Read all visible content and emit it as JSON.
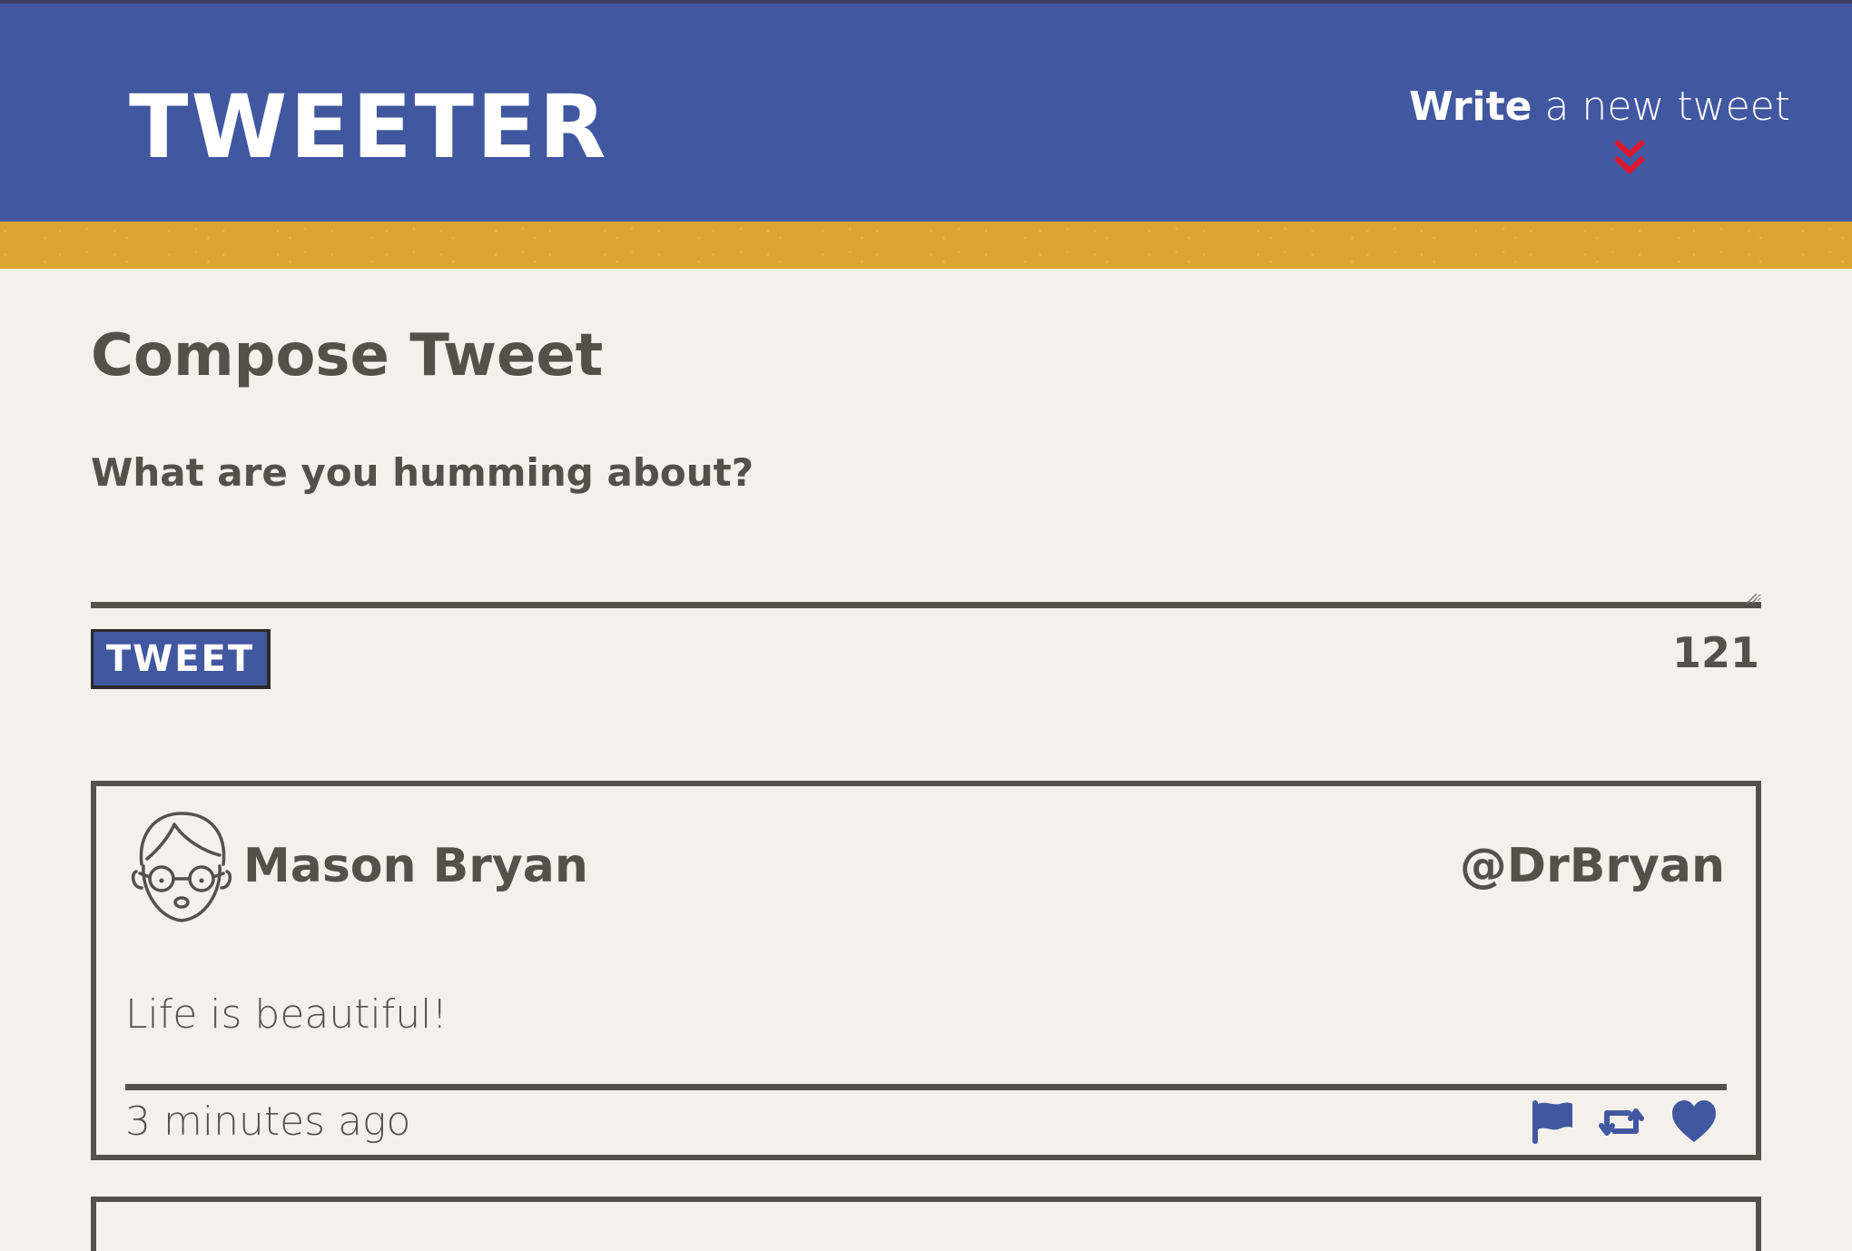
{
  "nav": {
    "brand": "TWEETER",
    "write_bold": "Write",
    "write_rest": " a new tweet",
    "chevron_icon": "double-chevron-down-icon",
    "colors": {
      "nav_bg": "#4158a0",
      "accent_stripe": "#dca532",
      "chevron": "#e0182e"
    }
  },
  "compose": {
    "title": "Compose Tweet",
    "prompt": "What are you humming about?",
    "input_value": "",
    "submit_label": "TWEET",
    "char_counter": "121"
  },
  "tweets": [
    {
      "avatar_icon": "person-with-glasses-avatar-icon",
      "name": "Mason Bryan",
      "handle": "@DrBryan",
      "content": "Life is beautiful!",
      "time": "3 minutes ago",
      "actions": [
        "flag-icon",
        "retweet-icon",
        "heart-icon"
      ]
    }
  ]
}
